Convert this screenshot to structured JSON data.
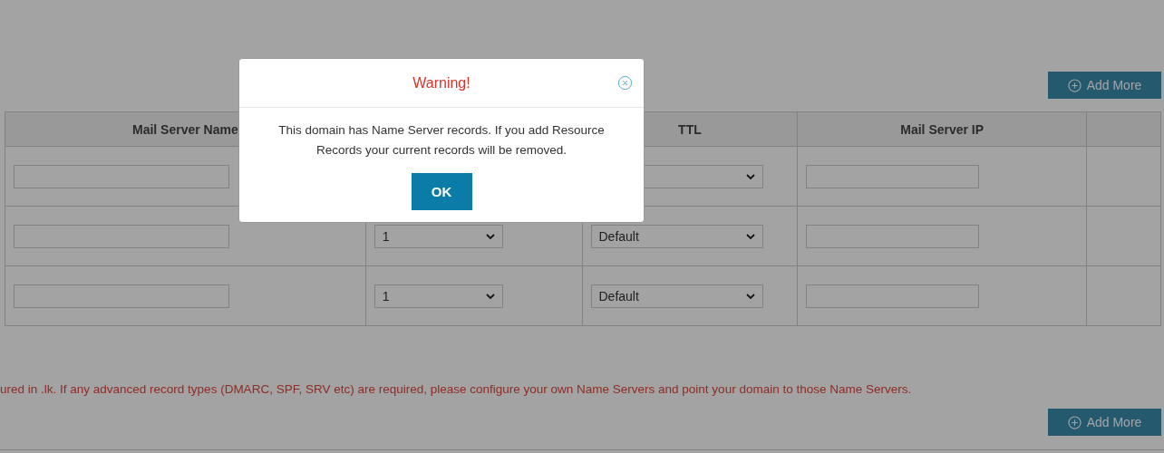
{
  "top_button": {
    "label": "Add More"
  },
  "table": {
    "columns": [
      {
        "label": "Mail Server Name"
      },
      {},
      {
        "label": "TTL"
      },
      {
        "label": "Mail Server IP"
      },
      {}
    ],
    "rows": [
      {
        "cells": [
          {
            "kind": "input"
          },
          {
            "kind": "covered"
          },
          {
            "kind": "select"
          },
          {
            "kind": "input"
          },
          {
            "kind": "empty"
          }
        ]
      },
      {
        "cells": [
          {
            "kind": "input"
          },
          {
            "kind": "select",
            "value": "1"
          },
          {
            "kind": "select",
            "value": "Default"
          },
          {
            "kind": "input"
          },
          {
            "kind": "empty"
          }
        ]
      },
      {
        "cells": [
          {
            "kind": "input"
          },
          {
            "kind": "select",
            "value": "1"
          },
          {
            "kind": "select",
            "value": "Default"
          },
          {
            "kind": "input"
          },
          {
            "kind": "empty"
          }
        ]
      }
    ]
  },
  "notice": "ured in .lk. If any advanced record types (DMARC, SPF, SRV etc) are required, please configure your own Name Servers and point your domain to those Name Servers.",
  "bottom_button": {
    "label": "Add More"
  },
  "modal": {
    "title": "Warning!",
    "message": "This domain has Name Server records. If you add Resource Records your current records will be removed.",
    "ok_button": "OK"
  }
}
